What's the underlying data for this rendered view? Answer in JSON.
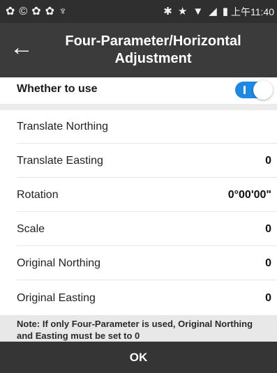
{
  "status_bar": {
    "left_icons": [
      "notification-icon",
      "sync-icon",
      "notification-icon",
      "notification-icon",
      "usb-icon"
    ],
    "left_glyphs": [
      "✿",
      "©",
      "✿",
      "✿",
      "♆"
    ],
    "right_glyphs": [
      "✱",
      "★",
      "▼",
      "◢",
      "▮"
    ],
    "right_icons": [
      "bluetooth-icon",
      "star-icon",
      "wifi-icon",
      "signal-icon",
      "battery-icon"
    ],
    "time": "上午11:40"
  },
  "app_bar": {
    "back_glyph": "←",
    "title": "Four-Parameter/Horizontal Adjustment"
  },
  "whether_to_use": {
    "label": "Whether to use",
    "enabled": true,
    "accent_color": "#1e88e5"
  },
  "fields": [
    {
      "label": "Translate Northing",
      "value": ""
    },
    {
      "label": "Translate Easting",
      "value": "0"
    },
    {
      "label": "Rotation",
      "value": "0°00'00\""
    },
    {
      "label": "Scale",
      "value": "0"
    },
    {
      "label": "Original Northing",
      "value": "0"
    },
    {
      "label": "Original Easting",
      "value": "0"
    }
  ],
  "note": "Note: If only Four-Parameter is used, Original Northing and Easting must be set to 0",
  "ok_button": "OK"
}
